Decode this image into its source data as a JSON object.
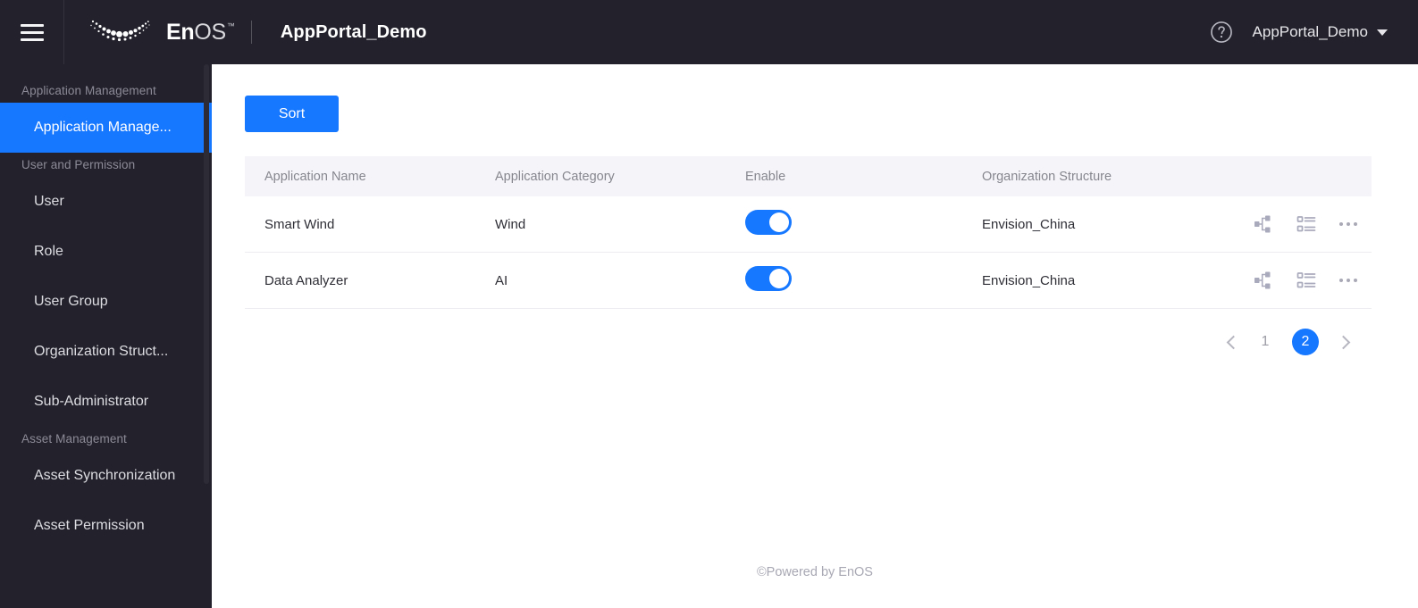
{
  "header": {
    "menu_icon": "hamburger-menu-icon",
    "logo_en": "En",
    "logo_os": "OS",
    "logo_tm": "™",
    "app_title": "AppPortal_Demo",
    "help_icon": "question-mark-circle-icon",
    "user_name": "AppPortal_Demo",
    "caret_icon": "chevron-down-icon"
  },
  "sidebar": {
    "groups": [
      {
        "label": "Application Management",
        "items": [
          {
            "label": "Application Manage...",
            "active": true
          }
        ]
      },
      {
        "label": "User and Permission",
        "items": [
          {
            "label": "User",
            "active": false
          },
          {
            "label": "Role",
            "active": false
          },
          {
            "label": "User Group",
            "active": false
          },
          {
            "label": "Organization Struct...",
            "active": false
          },
          {
            "label": "Sub-Administrator",
            "active": false
          }
        ]
      },
      {
        "label": "Asset Management",
        "items": [
          {
            "label": "Asset Synchronization",
            "active": false
          },
          {
            "label": "Asset Permission",
            "active": false
          }
        ]
      }
    ]
  },
  "toolbar": {
    "sort_label": "Sort"
  },
  "table": {
    "columns": [
      "Application Name",
      "Application Category",
      "Enable",
      "Organization Structure"
    ],
    "rows": [
      {
        "name": "Smart Wind",
        "category": "Wind",
        "enabled": true,
        "organization": "Envision_China",
        "actions": [
          "org-structure-icon",
          "list-detail-icon",
          "more-options-icon"
        ]
      },
      {
        "name": "Data Analyzer",
        "category": "AI",
        "enabled": true,
        "organization": "Envision_China",
        "actions": [
          "org-structure-icon",
          "list-detail-icon",
          "more-options-icon"
        ]
      }
    ]
  },
  "pagination": {
    "prev_icon": "chevron-left-icon",
    "next_icon": "chevron-right-icon",
    "pages": [
      "1",
      "2"
    ],
    "current": "2"
  },
  "footer": {
    "text": "©Powered by EnOS"
  },
  "colors": {
    "accent": "#1677ff",
    "header_bg": "#23222c",
    "sidebar_bg": "#23222c",
    "table_header_bg": "#f5f5f9"
  }
}
